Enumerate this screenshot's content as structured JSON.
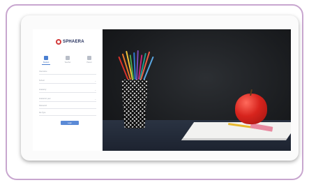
{
  "brand": {
    "logo_text": "SPHAERA"
  },
  "role_tabs": [
    {
      "label": "Student",
      "active": true
    },
    {
      "label": "Teacher",
      "active": false
    },
    {
      "label": "Parent",
      "active": false
    }
  ],
  "form": {
    "fields": [
      {
        "label": "Username",
        "dropdown": false
      },
      {
        "label": "School",
        "dropdown": true
      },
      {
        "label": "Academy",
        "dropdown": true
      },
      {
        "label": "Academic year",
        "dropdown": true
      },
      {
        "label": "Password",
        "dropdown": false
      },
      {
        "label": "Re-Type",
        "dropdown": false
      }
    ],
    "submit_label": "Login"
  },
  "colors": {
    "accent": "#4a7fd1",
    "frame_border": "#c8a6cf",
    "button": "#5b8ad6"
  },
  "hero": {
    "description_icon": "classroom-photo",
    "pencil_colors": [
      "#d9332b",
      "#e8792a",
      "#f0c43a",
      "#4aa34e",
      "#2f7bd0",
      "#7a4bb8",
      "#c4287a",
      "#1f9c8f",
      "#e85c45",
      "#5aa6e0"
    ]
  }
}
